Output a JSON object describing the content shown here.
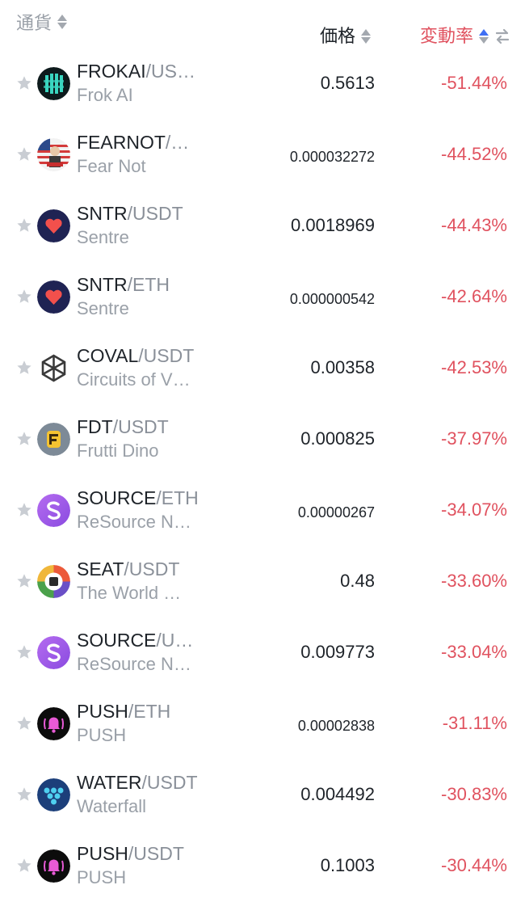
{
  "header": {
    "name_label": "通貨",
    "price_label": "価格",
    "change_label": "変動率"
  },
  "colors": {
    "negative": "#e0525f",
    "muted": "#9aa0a8",
    "active_sort": "#3f6ff4"
  },
  "rows": [
    {
      "base": "FROKAI",
      "quote": "/US…",
      "name": "Frok AI",
      "price": "0.5613",
      "change": "-51.44%",
      "icon": "frokai-logo-icon"
    },
    {
      "base": "FEARNOT",
      "quote": "/…",
      "name": "Fear Not",
      "price": "0.000032272",
      "change": "-44.52%",
      "icon": "fearnot-logo-icon"
    },
    {
      "base": "SNTR",
      "quote": "/USDT",
      "name": "Sentre",
      "price": "0.0018969",
      "change": "-44.43%",
      "icon": "sentre-logo-icon"
    },
    {
      "base": "SNTR",
      "quote": "/ETH",
      "name": "Sentre",
      "price": "0.000000542",
      "change": "-42.64%",
      "icon": "sentre-logo-icon"
    },
    {
      "base": "COVAL",
      "quote": "/USDT",
      "name": "Circuits of V…",
      "price": "0.00358",
      "change": "-42.53%",
      "icon": "coval-logo-icon"
    },
    {
      "base": "FDT",
      "quote": "/USDT",
      "name": "Frutti Dino",
      "price": "0.000825",
      "change": "-37.97%",
      "icon": "frutti-dino-logo-icon"
    },
    {
      "base": "SOURCE",
      "quote": "/ETH",
      "name": "ReSource N…",
      "price": "0.00000267",
      "change": "-34.07%",
      "icon": "resource-logo-icon"
    },
    {
      "base": "SEAT",
      "quote": "/USDT",
      "name": "The World …",
      "price": "0.48",
      "change": "-33.60%",
      "icon": "seat-logo-icon"
    },
    {
      "base": "SOURCE",
      "quote": "/U…",
      "name": "ReSource N…",
      "price": "0.009773",
      "change": "-33.04%",
      "icon": "resource-logo-icon"
    },
    {
      "base": "PUSH",
      "quote": "/ETH",
      "name": "PUSH",
      "price": "0.00002838",
      "change": "-31.11%",
      "icon": "push-logo-icon"
    },
    {
      "base": "WATER",
      "quote": "/USDT",
      "name": "Waterfall",
      "price": "0.004492",
      "change": "-30.83%",
      "icon": "waterfall-logo-icon"
    },
    {
      "base": "PUSH",
      "quote": "/USDT",
      "name": "PUSH",
      "price": "0.1003",
      "change": "-30.44%",
      "icon": "push-logo-icon"
    }
  ]
}
